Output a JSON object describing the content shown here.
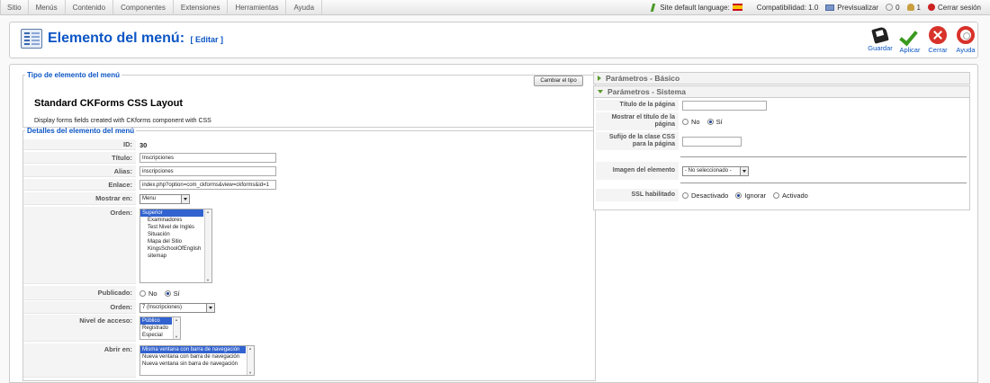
{
  "menubar": {
    "items": [
      "Sitio",
      "Menús",
      "Contenido",
      "Componentes",
      "Extensiones",
      "Herramientas",
      "Ayuda"
    ]
  },
  "status": {
    "language": "Site default language:",
    "compat": "Compatibilidad: 1.0",
    "preview": "Previsualizar",
    "messages": "0",
    "users": "1",
    "logout": "Cerrar sesión"
  },
  "header": {
    "title": "Elemento del menú:",
    "subtitle": "[ Editar ]"
  },
  "toolbar": {
    "save": "Guardar",
    "apply": "Aplicar",
    "close": "Cerrar",
    "help": "Ayuda"
  },
  "type_section": {
    "legend": "Tipo de elemento del menú",
    "name": "Standard CKForms CSS Layout",
    "description": "Display forms fields created with CKforms component with CSS",
    "change_button": "Cambiar el tipo"
  },
  "details": {
    "legend": "Detalles del elemento del menú",
    "id_label": "ID:",
    "id_value": "30",
    "title_label": "Título:",
    "title_value": "Inscripciones",
    "alias_label": "Alias:",
    "alias_value": "inscripciones",
    "link_label": "Enlace:",
    "link_value": "index.php?option=com_ckforms&view=ckforms&id=1",
    "show_in_label": "Mostrar en:",
    "show_in_value": "Menu",
    "order_label": "Orden:",
    "order_list": [
      "Superior",
      "Examinadores",
      "Test Nivel de Inglés",
      "Situación",
      "Mapa del Sitio",
      "KingsSchoolOfEnglish",
      "sitemap"
    ],
    "published_label": "Publicado:",
    "published_no": "No",
    "published_yes": "Sí",
    "order2_label": "Orden:",
    "order2_value": "7 (Inscripciones)",
    "access_label": "Nivel de acceso:",
    "access_options": [
      "Público",
      "Registrado",
      "Especial"
    ],
    "open_in_label": "Abrir en:",
    "open_in_options": [
      "Misma ventana con barra de navegación",
      "Nueva ventana con barra de navegación",
      "Nueva ventana sin barra de navegación"
    ]
  },
  "params": {
    "basic_title": "Parámetros - Básico",
    "system_title": "Parámetros - Sistema",
    "page_title_label": "Título de la página",
    "show_title_label": "Mostrar el título de la página",
    "show_title_no": "No",
    "show_title_yes": "Sí",
    "css_suffix_label": "Sufijo de la clase CSS para la página",
    "image_label": "Imagen del elemento",
    "image_value": "- No seleccionado -",
    "ssl_label": "SSL habilitado",
    "ssl_off": "Desactivado",
    "ssl_ignore": "Ignorar",
    "ssl_on": "Activado"
  }
}
